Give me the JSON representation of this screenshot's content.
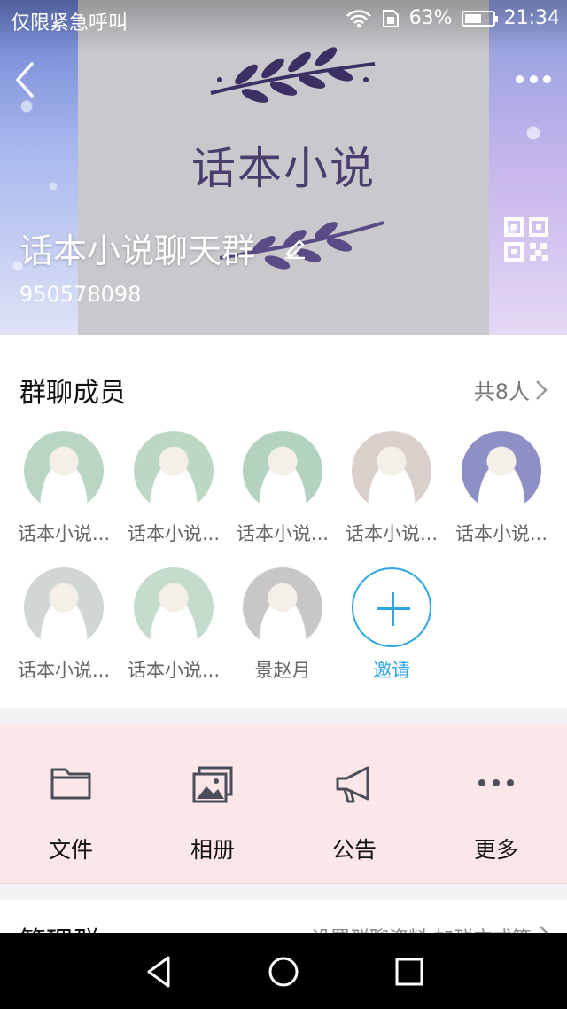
{
  "status_bar": {
    "carrier": "仅限紧急呼叫",
    "battery": "63%",
    "battery_level": 0.63,
    "time": "21:34"
  },
  "banner": {
    "art_text": "话本小说"
  },
  "group": {
    "name": "话本小说聊天群",
    "id": "950578098"
  },
  "members": {
    "title": "群聊成员",
    "count_label": "共8人",
    "list": [
      {
        "name": "话本小说...",
        "color": "#b9d6c5"
      },
      {
        "name": "话本小说...",
        "color": "#bcd8c4"
      },
      {
        "name": "话本小说...",
        "color": "#b4d2c0"
      },
      {
        "name": "话本小说...",
        "color": "#d9d0cb"
      },
      {
        "name": "话本小说...",
        "color": "#8e8fc4"
      },
      {
        "name": "话本小说...",
        "color": "#cfd6d4"
      },
      {
        "name": "话本小说...",
        "color": "#c5dccd"
      },
      {
        "name": "景赵月",
        "color": "#c9c6c8"
      }
    ],
    "invite_label": "邀请"
  },
  "tools": [
    {
      "label": "文件",
      "icon": "folder-icon"
    },
    {
      "label": "相册",
      "icon": "album-icon"
    },
    {
      "label": "公告",
      "icon": "megaphone-icon"
    },
    {
      "label": "更多",
      "icon": "more-dots-icon"
    }
  ],
  "manage": {
    "title": "管理群",
    "subtitle": "设置群聊资料 加群方式等"
  },
  "colors": {
    "accent": "#2ea6e6",
    "tools_bg": "#fde6e8",
    "banner_text": "#4a3d6c"
  }
}
